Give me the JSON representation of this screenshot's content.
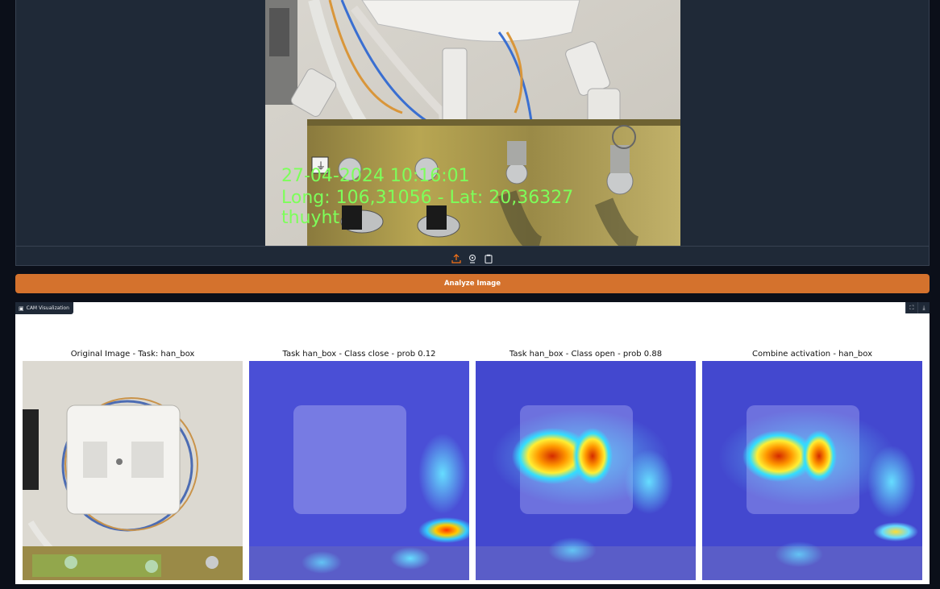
{
  "upload": {
    "overlay": {
      "timestamp": "27-04-2024 10:16:01",
      "coords": "Long: 106,31056 - Lat: 20,36327",
      "user": "thuyht"
    },
    "toolbar_icons": [
      "upload-icon",
      "webcam-icon",
      "clipboard-icon"
    ]
  },
  "analyze_button": {
    "label": "Analyze Image"
  },
  "cam": {
    "label": "CAM Visualization",
    "actions": [
      "fullscreen-icon",
      "download-icon"
    ],
    "panels": [
      {
        "title": "Original Image - Task: han_box"
      },
      {
        "title": "Task han_box - Class close - prob 0.12"
      },
      {
        "title": "Task han_box - Class open - prob 0.88"
      },
      {
        "title": "Combine activation - han_box"
      }
    ]
  },
  "colors": {
    "accent": "#d4722d",
    "dark_bg": "#0b0f19",
    "panel_bg": "#1f2937",
    "overlay_text": "#7dff5a"
  }
}
